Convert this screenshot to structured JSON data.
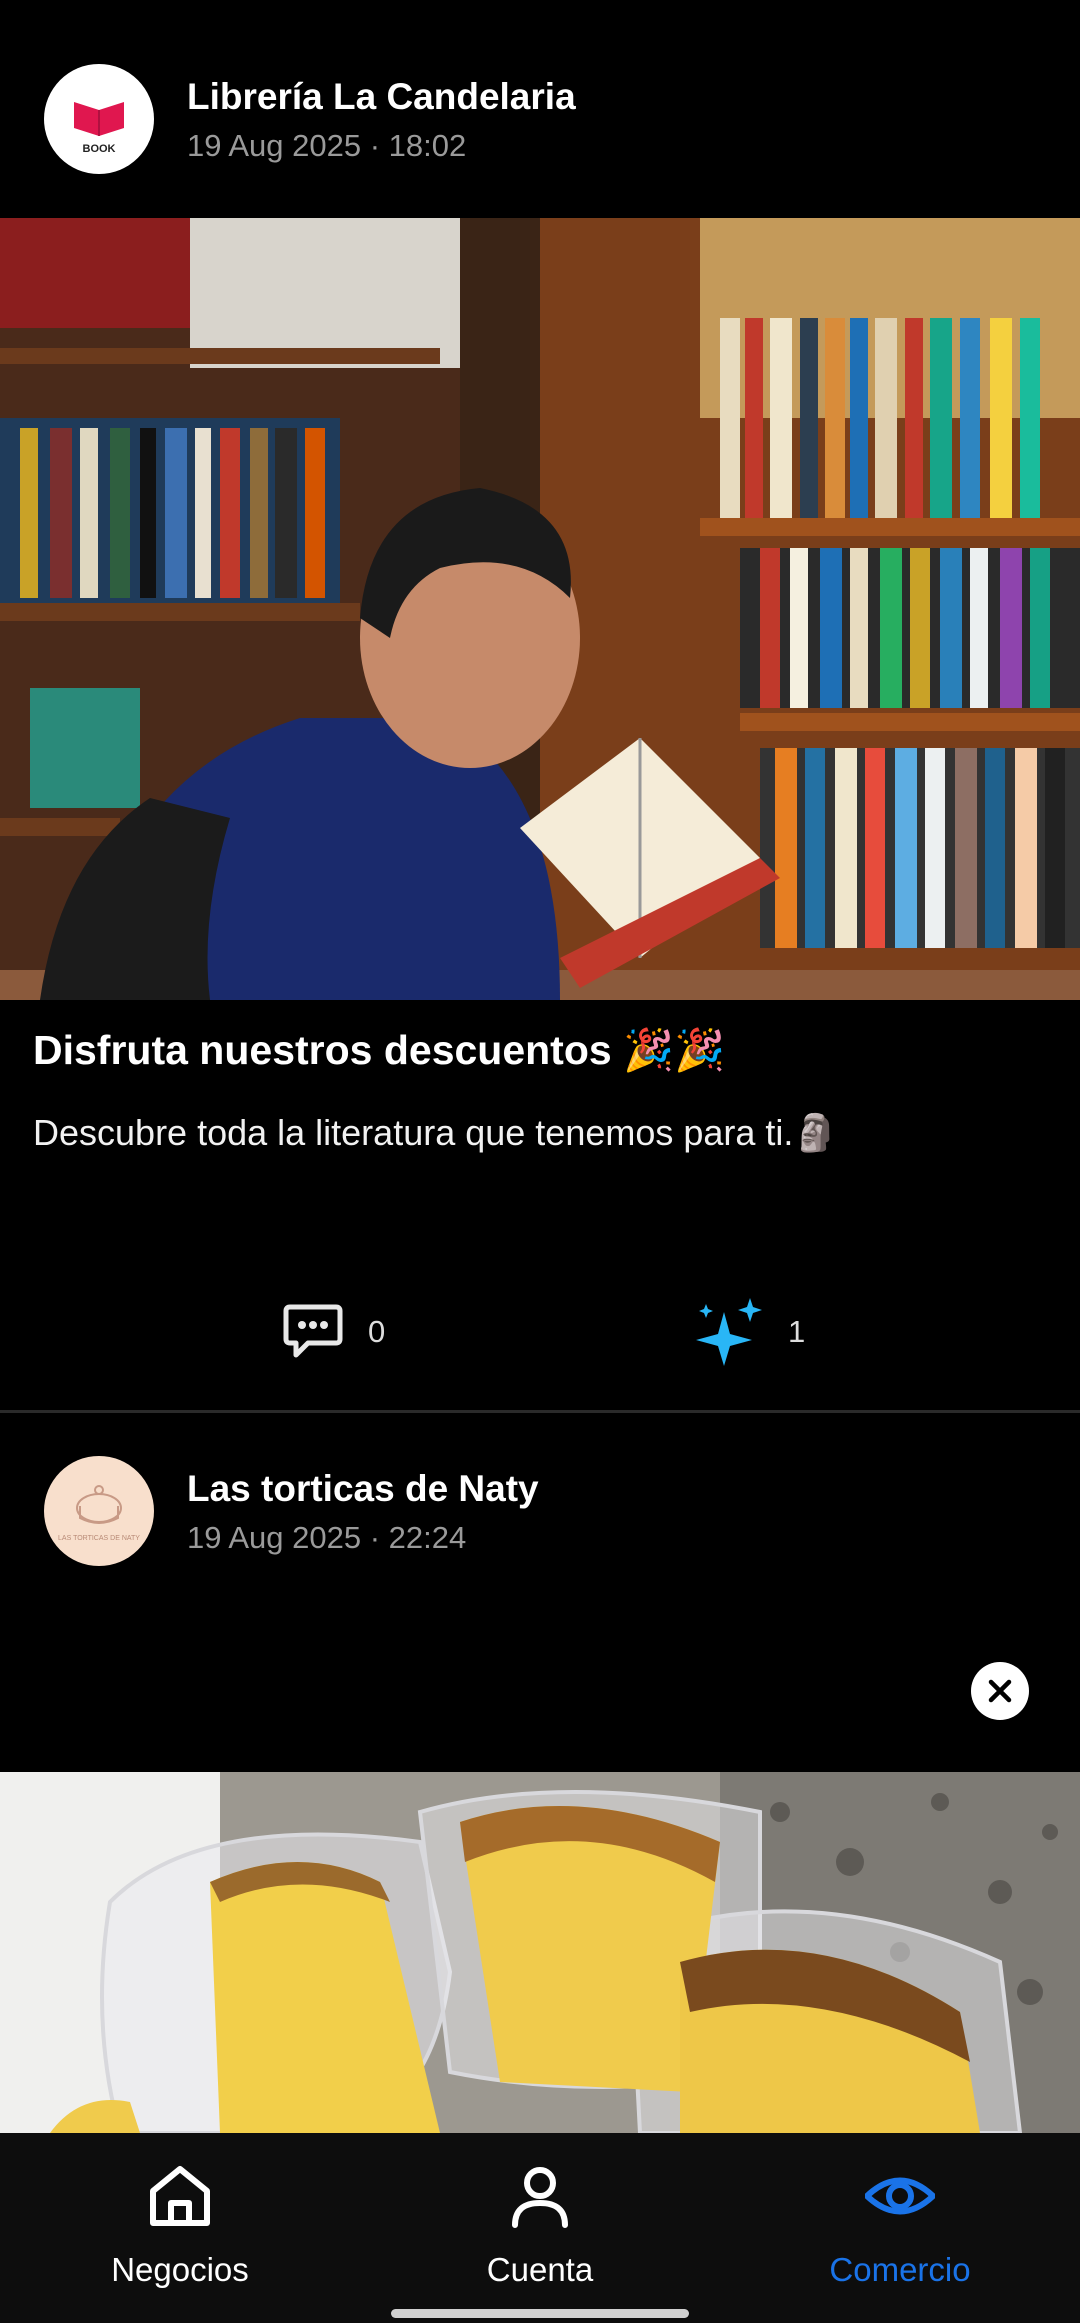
{
  "posts": [
    {
      "author": "Librería La Candelaria",
      "avatar_text": "BOOK",
      "date": "19 Aug 2025 · 18:02",
      "title": "Disfruta nuestros descuentos 🎉🎉",
      "description": "Descubre toda la literatura que tenemos para ti.🗿",
      "comments": "0",
      "likes": "1",
      "image_alt": "Hombre leyendo un libro en una librería"
    },
    {
      "author": "Las torticas de Naty",
      "avatar_text": "LAS TORTICAS DE NATY",
      "date": "19 Aug 2025 · 22:24",
      "image_alt": "Porciones de torta en recipientes plásticos"
    }
  ],
  "nav": {
    "items": [
      {
        "label": "Negocios",
        "icon": "home-icon"
      },
      {
        "label": "Cuenta",
        "icon": "person-icon"
      },
      {
        "label": "Comercio",
        "icon": "eye-icon",
        "active": true
      }
    ],
    "active_color": "#1a73e8",
    "sparkle_color": "#29b6f6"
  }
}
